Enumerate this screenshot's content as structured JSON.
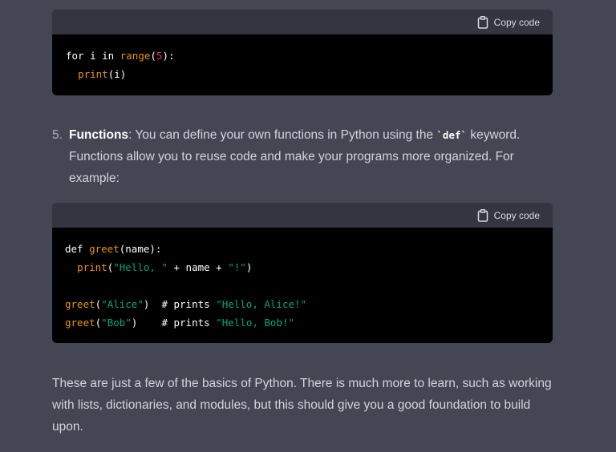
{
  "block1": {
    "copy_label": "Copy code",
    "lines": [
      [
        {
          "t": "for",
          "c": "kw"
        },
        {
          "t": " i ",
          "c": ""
        },
        {
          "t": "in",
          "c": "kw"
        },
        {
          "t": " ",
          "c": ""
        },
        {
          "t": "range",
          "c": "bi"
        },
        {
          "t": "(",
          "c": ""
        },
        {
          "t": "5",
          "c": "num"
        },
        {
          "t": "):",
          "c": ""
        }
      ],
      [
        {
          "t": "  ",
          "c": ""
        },
        {
          "t": "print",
          "c": "bi"
        },
        {
          "t": "(i)",
          "c": ""
        }
      ]
    ]
  },
  "item5": {
    "number": "5.",
    "title": "Functions",
    "text_before": ": You can define your own functions in Python using the ",
    "code": "`def`",
    "text_after": " keyword.",
    "line2": "Functions allow you to reuse code and make your programs more organized. For",
    "line3": "example:"
  },
  "block2": {
    "copy_label": "Copy code",
    "lines": [
      [
        {
          "t": "def",
          "c": "kw"
        },
        {
          "t": " ",
          "c": ""
        },
        {
          "t": "greet",
          "c": "fnamber"
        },
        {
          "t": "(name):",
          "c": ""
        }
      ],
      [
        {
          "t": "  ",
          "c": ""
        },
        {
          "t": "print",
          "c": "bi"
        },
        {
          "t": "(",
          "c": ""
        },
        {
          "t": "\"Hello, \"",
          "c": "str"
        },
        {
          "t": " + name + ",
          "c": ""
        },
        {
          "t": "\"!\"",
          "c": "str"
        },
        {
          "t": ")",
          "c": ""
        }
      ],
      [],
      [
        {
          "t": "greet",
          "c": "fnamber"
        },
        {
          "t": "(",
          "c": ""
        },
        {
          "t": "\"Alice\"",
          "c": "str"
        },
        {
          "t": ")  ",
          "c": ""
        },
        {
          "t": "# prints ",
          "c": "cm"
        },
        {
          "t": "\"Hello, Alice!\"",
          "c": "str"
        }
      ],
      [
        {
          "t": "greet",
          "c": "fnamber"
        },
        {
          "t": "(",
          "c": ""
        },
        {
          "t": "\"Bob\"",
          "c": "str"
        },
        {
          "t": ")    ",
          "c": ""
        },
        {
          "t": "# prints ",
          "c": "cm"
        },
        {
          "t": "\"Hello, Bob!\"",
          "c": "str"
        }
      ]
    ]
  },
  "closing": {
    "line1": "These are just a few of the basics of Python. There is much more to learn, such as working",
    "line2": "with lists, dictionaries, and modules, but this should give you a good foundation to build",
    "line3": "upon."
  }
}
